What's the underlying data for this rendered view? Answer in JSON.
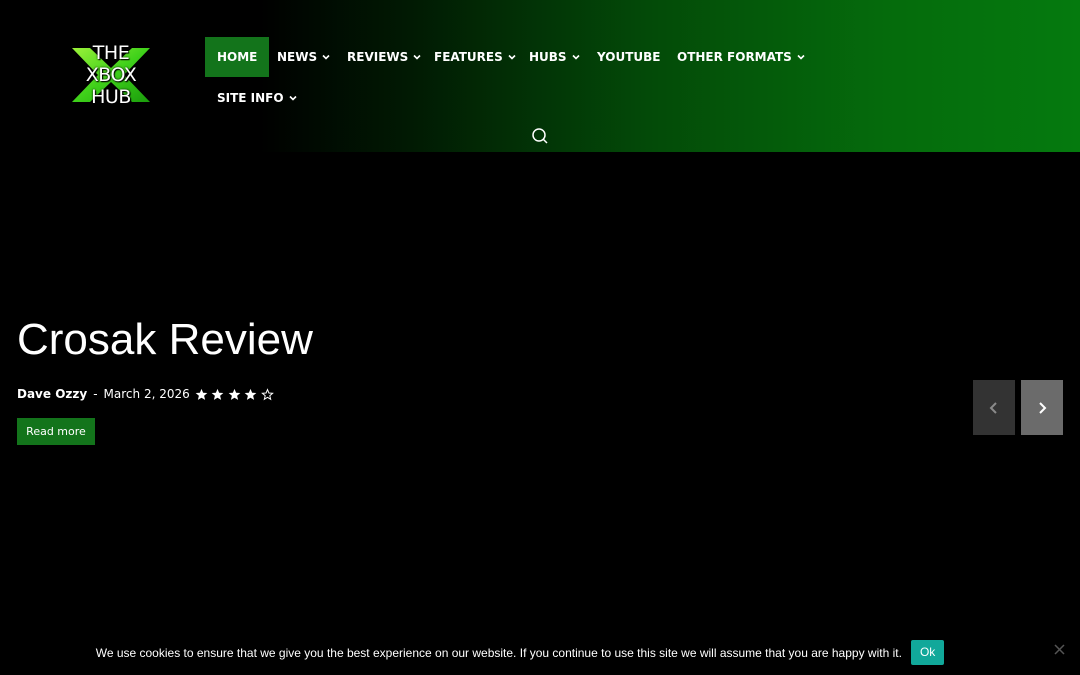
{
  "logo": {
    "lines": [
      "THE",
      "XBOX",
      "HUB"
    ]
  },
  "nav": {
    "items": [
      {
        "label": "HOME",
        "has_dropdown": false,
        "active": true
      },
      {
        "label": "NEWS",
        "has_dropdown": true
      },
      {
        "label": "REVIEWS",
        "has_dropdown": true
      },
      {
        "label": "FEATURES",
        "has_dropdown": true
      },
      {
        "label": "HUBS",
        "has_dropdown": true
      },
      {
        "label": "YOUTUBE",
        "has_dropdown": false
      },
      {
        "label": "OTHER FORMATS",
        "has_dropdown": true
      },
      {
        "label": "SITE INFO",
        "has_dropdown": true
      }
    ],
    "search_icon": "search-icon"
  },
  "hero": {
    "title": "Crosak Review",
    "author": "Dave Ozzy",
    "separator": "-",
    "date": "March 2, 2026",
    "rating": 4,
    "rating_max": 5,
    "read_more": "Read more"
  },
  "slider": {
    "prev_icon": "chevron-left-icon",
    "next_icon": "chevron-right-icon"
  },
  "cookie": {
    "message": "We use cookies to ensure that we give you the best experience on our website. If you continue to use this site we will assume that you are happy with it.",
    "ok_label": "Ok",
    "close_icon": "close-icon"
  },
  "colors": {
    "accent_green": "#13741b",
    "header_gradient_end": "#057a0e",
    "cookie_ok": "#11a89a",
    "slider_prev_bg": "#333333",
    "slider_next_bg": "#6b6b6b"
  }
}
